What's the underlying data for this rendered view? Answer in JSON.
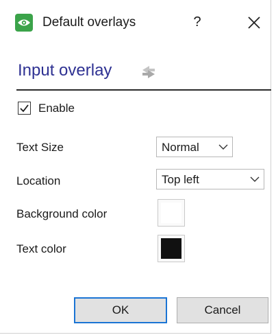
{
  "window": {
    "title": "Default overlays",
    "help_label": "?",
    "icon": "eye-icon",
    "accent_color": "#3ba34a"
  },
  "section": {
    "title": "Input overlay",
    "title_color": "#2e3192",
    "icon": "refresh-icon"
  },
  "enable": {
    "label": "Enable",
    "checked": true
  },
  "fields": {
    "text_size": {
      "label": "Text Size",
      "value": "Normal"
    },
    "location": {
      "label": "Location",
      "value": "Top left"
    },
    "background_color": {
      "label": "Background color",
      "value": "#ffffff"
    },
    "text_color": {
      "label": "Text color",
      "value": "#111111"
    }
  },
  "buttons": {
    "ok": "OK",
    "cancel": "Cancel"
  }
}
